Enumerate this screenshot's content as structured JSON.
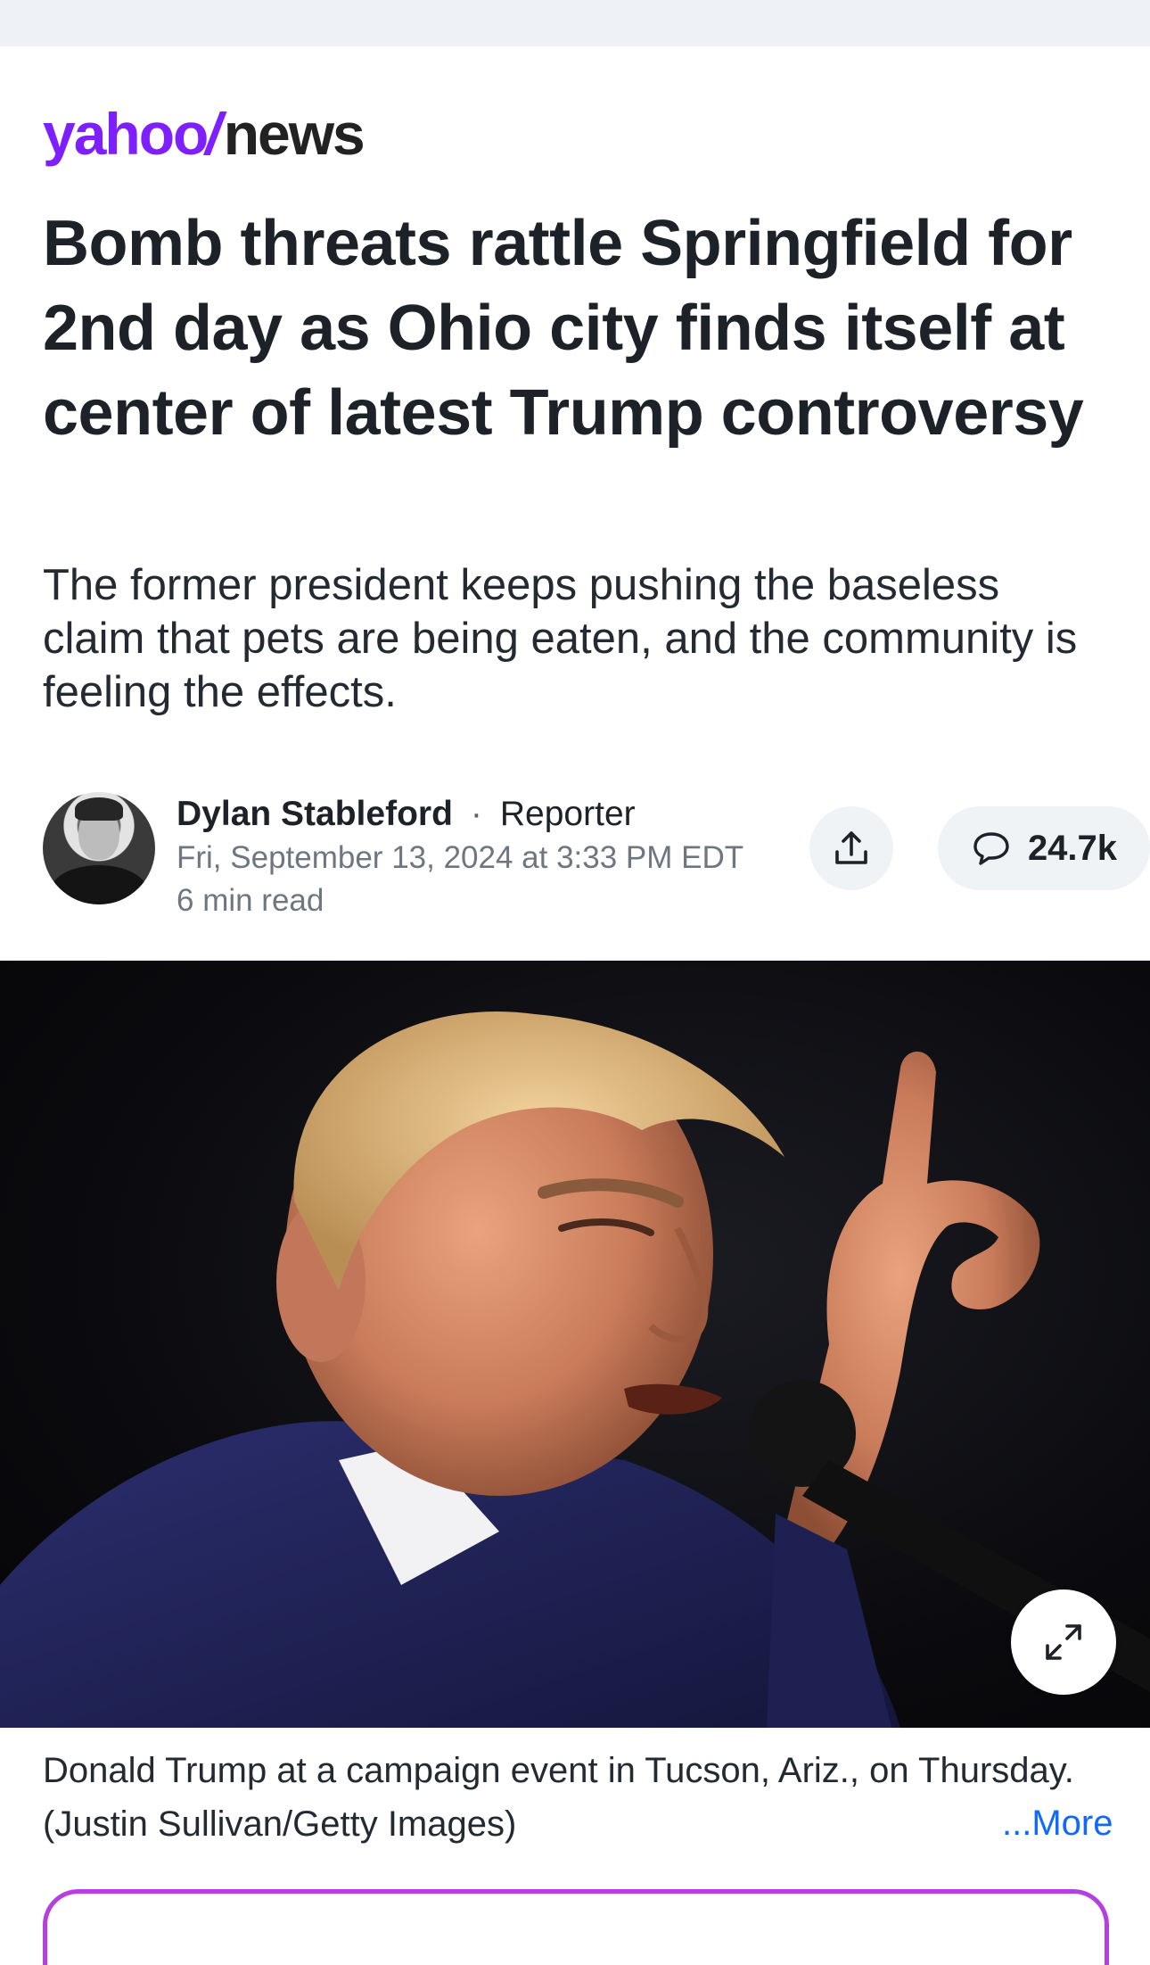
{
  "brand": {
    "yahoo": "yahoo",
    "slash": "/",
    "news": "news",
    "color": "#7e1fff"
  },
  "article": {
    "headline": "Bomb threats rattle Springfield for 2nd day as Ohio city finds itself at center of latest Trump controversy",
    "subheadline": "The former president keeps pushing the baseless claim that pets are being eaten, and the community is feeling the effects.",
    "author": {
      "name": "Dylan Stableford",
      "separator": "·",
      "role": "Reporter"
    },
    "date": "Fri, September 13, 2024 at 3:33 PM EDT",
    "read_time": "6 min read"
  },
  "actions": {
    "share_icon": "share-icon",
    "comment_icon": "comment-bubble-icon",
    "comments_count": "24.7k"
  },
  "image": {
    "expand_icon": "expand-icon",
    "caption": "Donald Trump at a campaign event in Tucson, Ariz., on Thursday. (Justin Sullivan/Getty Images)",
    "more_link": "...More"
  },
  "colors": {
    "link": "#0f69ff",
    "promo_border": "#b63fe0",
    "top_bar": "#eef1f5"
  }
}
